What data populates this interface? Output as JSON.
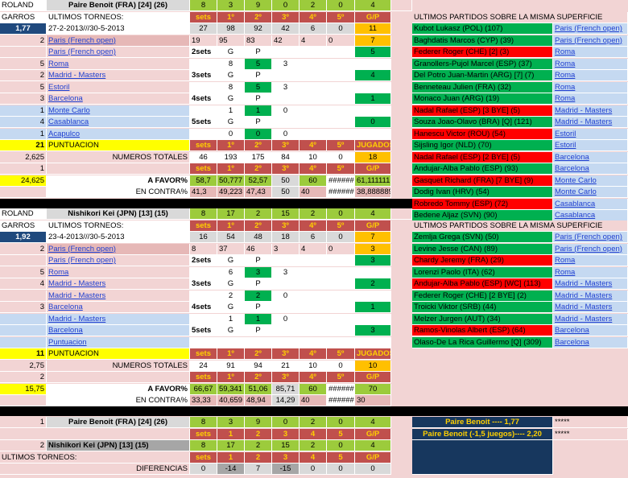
{
  "colors": {
    "header_red": "#c0504d",
    "green": "#9ccb3c",
    "dark_green": "#00b050",
    "bright_red": "#ff0000",
    "navy": "#17375e",
    "yellow": "#ffff00",
    "orange": "#ffc000",
    "light_blue": "#c5d9f1",
    "pink": "#f2d4d4"
  },
  "p1": {
    "label1": "ROLAND",
    "label2": "GARROS",
    "odds": "1,77",
    "name": "Paire Benoit (FRA) [24] (26)",
    "top": [
      "8",
      "3",
      "9",
      "0",
      "2",
      "0",
      "4"
    ],
    "ultimos": "ULTIMOS TORNEOS:",
    "hdr": [
      "sets",
      "1º",
      "2º",
      "3º",
      "4º",
      "5º",
      "G/P"
    ],
    "period": "27-2-2013///30-5-2013",
    "r1": [
      "27",
      "98",
      "92",
      "42",
      "6",
      "0",
      "11"
    ],
    "r2n": "2",
    "r2t": "Paris (French open)",
    "r2": [
      "19",
      "95",
      "83",
      "42",
      "4",
      "0",
      "7"
    ],
    "tourn": [
      {
        "n": "",
        "name": "Paris (French open)",
        "s": "2sets",
        "g": "G",
        "p": "P",
        "a": "",
        "b": "",
        "v": "5"
      },
      {
        "n": "5",
        "name": "Roma",
        "s": "",
        "g": "8",
        "p": "5",
        "a": "3",
        "b": "",
        "v": ""
      },
      {
        "n": "2",
        "name": "Madrid - Masters",
        "s": "3sets",
        "g": "G",
        "p": "P",
        "a": "",
        "b": "",
        "v": "4"
      },
      {
        "n": "5",
        "name": "Estoril",
        "s": "",
        "g": "8",
        "p": "5",
        "a": "3",
        "b": "",
        "v": ""
      },
      {
        "n": "3",
        "name": "Barcelona",
        "s": "4sets",
        "g": "G",
        "p": "P",
        "a": "",
        "b": "",
        "v": "1"
      },
      {
        "n": "1",
        "name": "Monte Carlo",
        "s": "",
        "g": "1",
        "p": "1",
        "a": "0",
        "b": "",
        "v": ""
      },
      {
        "n": "4",
        "name": "Casablanca",
        "s": "5sets",
        "g": "G",
        "p": "P",
        "a": "",
        "b": "",
        "v": "0"
      },
      {
        "n": "1",
        "name": "Acapulco",
        "s": "",
        "g": "0",
        "p": "0",
        "a": "0",
        "b": "",
        "v": ""
      }
    ],
    "punt_n": "21",
    "punt": "PUNTUACION",
    "punt_hdr": [
      "sets",
      "1º",
      "2º",
      "3º",
      "4º",
      "5º",
      "JUGADOS"
    ],
    "tot_l": "2,625",
    "tot_lbl": "NUMEROS TOTALES",
    "tot": [
      "46",
      "193",
      "175",
      "84",
      "10",
      "0",
      "18"
    ],
    "tot2_l": "1",
    "tot2_hdr": [
      "sets",
      "1º",
      "2º",
      "3º",
      "4º",
      "5º",
      "G/P"
    ],
    "fav_l": "24,625",
    "fav_lbl": "A FAVOR%",
    "fav": [
      "58,7",
      "50,777",
      "52,57",
      "50",
      "60",
      "######",
      "61,111111"
    ],
    "con_lbl": "EN CONTRA%",
    "con": [
      "41,3",
      "49,223",
      "47,43",
      "50",
      "40",
      "######",
      "38,888889"
    ],
    "side_title": "ULTIMOS PARTIDOS SOBRE LA MISMA SUPERFICIE",
    "matches": [
      {
        "opp": "Kubot Lukasz (POL) (107)",
        "t": "Paris (French open)",
        "w": true
      },
      {
        "opp": "Baghdatis Marcos (CYP) (39)",
        "t": "Paris (French open)",
        "w": true
      },
      {
        "opp": "Federer Roger (CHE) [2] (3)",
        "t": "Roma",
        "w": false
      },
      {
        "opp": "Granollers-Pujol Marcel (ESP) (37)",
        "t": "Roma",
        "w": true
      },
      {
        "opp": "Del Potro Juan-Martin (ARG) [7] (7)",
        "t": "Roma",
        "w": true
      },
      {
        "opp": "Benneteau Julien (FRA) (32)",
        "t": "Roma",
        "w": true
      },
      {
        "opp": "Monaco Juan (ARG) (19)",
        "t": "Roma",
        "w": true
      },
      {
        "opp": "Nadal Rafael (ESP) [3 BYE] (5)",
        "t": "Madrid - Masters",
        "w": false
      },
      {
        "opp": "Souza Joao-Olavo (BRA) [Q] (121)",
        "t": "Madrid - Masters",
        "w": true
      },
      {
        "opp": "Hanescu Victor (ROU) (54)",
        "t": "Estoril",
        "w": false
      },
      {
        "opp": "Sijsling Igor (NLD) (70)",
        "t": "Estoril",
        "w": true
      },
      {
        "opp": "Nadal Rafael (ESP) [2 BYE] (5)",
        "t": "Barcelona",
        "w": false
      },
      {
        "opp": "Andujar-Alba Pablo (ESP) (93)",
        "t": "Barcelona",
        "w": true
      },
      {
        "opp": "Gasquet Richard (FRA) [7 BYE] (9)",
        "t": "Monte Carlo",
        "w": false
      },
      {
        "opp": "Dodig Ivan (HRV) (54)",
        "t": "Monte Carlo",
        "w": true
      },
      {
        "opp": "Robredo Tommy (ESP) (72)",
        "t": "Casablanca",
        "w": false
      },
      {
        "opp": "Bedene Aljaz (SVN) (90)",
        "t": "Casablanca",
        "w": true
      },
      {
        "opp": "Lorenzi Paolo (ITA) (57)",
        "t": "Acapulco",
        "w": false
      }
    ]
  },
  "p2": {
    "label1": "ROLAND",
    "label2": "GARROS",
    "odds": "1,92",
    "name": "Nishikori Kei (JPN) [13] (15)",
    "top": [
      "8",
      "17",
      "2",
      "15",
      "2",
      "0",
      "4"
    ],
    "ultimos": "ULTIMOS TORNEOS:",
    "hdr": [
      "sets",
      "1º",
      "2º",
      "3º",
      "4º",
      "5º",
      "G/P"
    ],
    "period": "23-4-2013///30-5-2013",
    "r1": [
      "16",
      "54",
      "48",
      "18",
      "6",
      "0",
      "7"
    ],
    "r2n": "2",
    "r2t": "Paris (French open)",
    "r2": [
      "8",
      "37",
      "46",
      "3",
      "4",
      "0",
      "3"
    ],
    "tourn": [
      {
        "n": "",
        "name": "Paris (French open)",
        "s": "2sets",
        "g": "G",
        "p": "P",
        "a": "",
        "b": "",
        "v": "3"
      },
      {
        "n": "5",
        "name": "Roma",
        "s": "",
        "g": "6",
        "p": "3",
        "a": "3",
        "b": "",
        "v": ""
      },
      {
        "n": "4",
        "name": "Madrid - Masters",
        "s": "3sets",
        "g": "G",
        "p": "P",
        "a": "",
        "b": "",
        "v": "2"
      },
      {
        "n": "",
        "name": "Madrid - Masters",
        "s": "",
        "g": "2",
        "p": "2",
        "a": "0",
        "b": "",
        "v": ""
      },
      {
        "n": "3",
        "name": "Barcelona",
        "s": "4sets",
        "g": "G",
        "p": "P",
        "a": "",
        "b": "",
        "v": "1"
      },
      {
        "n": "",
        "name": "Madrid - Masters",
        "s": "",
        "g": "1",
        "p": "1",
        "a": "0",
        "b": "",
        "v": ""
      },
      {
        "n": "",
        "name": "Barcelona",
        "s": "5sets",
        "g": "G",
        "p": "P",
        "a": "",
        "b": "",
        "v": "3"
      },
      {
        "n": "",
        "name": "Puntuacion",
        "s": "",
        "g": "",
        "p": "",
        "a": "",
        "b": "",
        "v": ""
      }
    ],
    "punt_n": "11",
    "punt": "PUNTUACION",
    "punt_hdr": [
      "sets",
      "1º",
      "2º",
      "3º",
      "4º",
      "5º",
      "JUGADOS"
    ],
    "tot_l": "2,75",
    "tot_lbl": "NUMEROS TOTALES",
    "tot": [
      "24",
      "91",
      "94",
      "21",
      "10",
      "0",
      "10"
    ],
    "tot2_l": "2",
    "tot2_hdr": [
      "sets",
      "1º",
      "2º",
      "3º",
      "4º",
      "5º",
      "G/P"
    ],
    "fav_l": "15,75",
    "fav_lbl": "A FAVOR%",
    "fav": [
      "66,67",
      "59,341",
      "51,06",
      "85,71",
      "60",
      "######",
      "70"
    ],
    "con_lbl": "EN CONTRA%",
    "con": [
      "33,33",
      "40,659",
      "48,94",
      "14,29",
      "40",
      "######",
      "30"
    ],
    "side_title": "ULTIMOS PARTIDOS SOBRE LA MISMA SUPERFICIE",
    "matches": [
      {
        "opp": "Zemlja Grega (SVN) (50)",
        "t": "Paris (French open)",
        "w": true
      },
      {
        "opp": "Levine Jesse (CAN) (89)",
        "t": "Paris (French open)",
        "w": true
      },
      {
        "opp": "Chardy Jeremy (FRA) (29)",
        "t": "Roma",
        "w": false
      },
      {
        "opp": "Lorenzi Paolo (ITA) (62)",
        "t": "Roma",
        "w": true
      },
      {
        "opp": "Andujar-Alba Pablo (ESP) [WC] (113)",
        "t": "Madrid - Masters",
        "w": false
      },
      {
        "opp": "Federer Roger (CHE) [2 BYE] (2)",
        "t": "Madrid - Masters",
        "w": true
      },
      {
        "opp": "Troicki Viktor (SRB) (44)",
        "t": "Madrid - Masters",
        "w": true
      },
      {
        "opp": "Melzer Jurgen (AUT) (34)",
        "t": "Madrid - Masters",
        "w": true
      },
      {
        "opp": "Ramos-Vinolas Albert (ESP) (64)",
        "t": "Barcelona",
        "w": false
      },
      {
        "opp": "Olaso-De La Rica Guillermo [Q] (309)",
        "t": "Barcelona",
        "w": true
      }
    ]
  },
  "summary": {
    "r1n": "1",
    "r1name": "Paire Benoit (FRA) [24] (26)",
    "r1": [
      "8",
      "3",
      "9",
      "0",
      "2",
      "0",
      "4"
    ],
    "hdr": [
      "sets",
      "1",
      "2",
      "3",
      "4",
      "5",
      "G/P"
    ],
    "r2n": "2",
    "r2name": "Nishikori Kei (JPN) [13] (15)",
    "r2": [
      "8",
      "17",
      "2",
      "15",
      "2",
      "0",
      "4"
    ],
    "ultimos": "ULTIMOS TORNEOS:",
    "hdr2": [
      "sets",
      "1",
      "2",
      "3",
      "4",
      "5",
      "G/P"
    ],
    "dif_lbl": "DIFERENCIAS",
    "dif": [
      "0",
      "-14",
      "7",
      "-15",
      "0",
      "0",
      "0"
    ],
    "box1": "Paire Benoit ---- 1,77",
    "box2": "Paire Benoit (-1,5 juegos)---- 2,20",
    "stars": "*****"
  }
}
